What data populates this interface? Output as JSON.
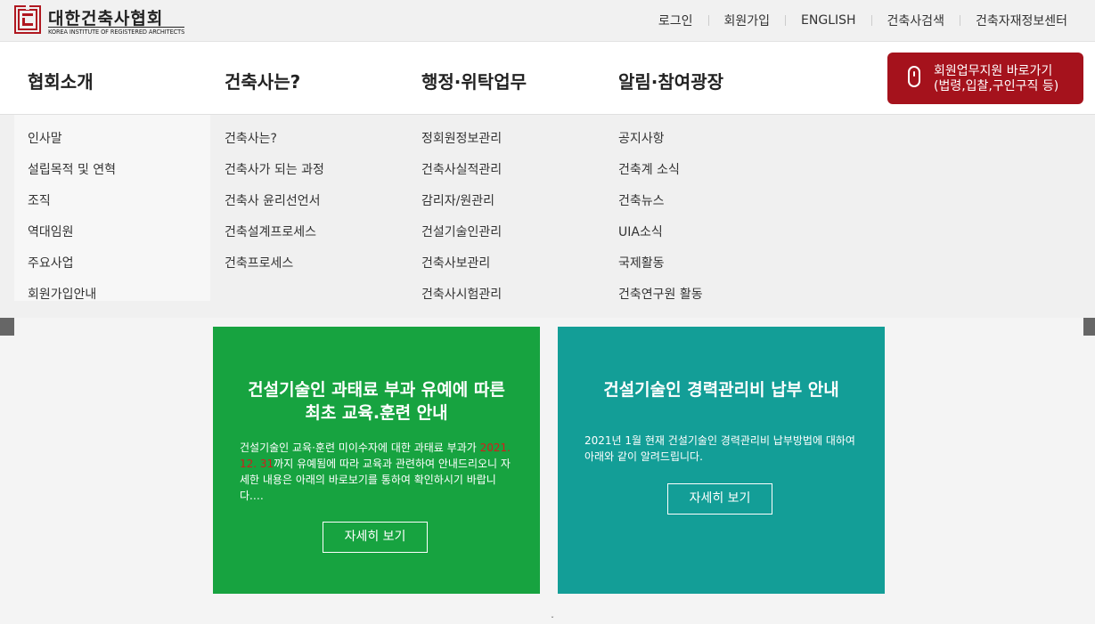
{
  "header": {
    "logo_text": "대한건축사협회",
    "logo_subtitle": "KOREA INSTITUTE OF REGISTERED ARCHITECTS",
    "util_links": [
      "로그인",
      "회원가입",
      "ENGLISH",
      "건축사검색",
      "건축자재정보센터"
    ]
  },
  "gnb": {
    "menus": [
      "협회소개",
      "건축사는?",
      "행정·위탁업무",
      "알림·참여광장"
    ],
    "member_button": {
      "line1": "회원업무지원 바로가기",
      "line2": "(법령,입찰,구인구직 등)"
    }
  },
  "dropdown": {
    "columns": [
      [
        "인사말",
        "설립목적 및 연혁",
        "조직",
        "역대임원",
        "주요사업",
        "회원가입안내"
      ],
      [
        "건축사는?",
        "건축사가 되는 과정",
        "건축사 윤리선언서",
        "건축설계프로세스",
        "건축프로세스"
      ],
      [
        "정회원정보관리",
        "건축사실적관리",
        "감리자/원관리",
        "건설기술인관리",
        "건축사보관리",
        "건축사시험관리"
      ],
      [
        "공지사항",
        "건축계 소식",
        "건축뉴스",
        "UIA소식",
        "국제활동",
        "건축연구원 활동"
      ]
    ]
  },
  "cards": [
    {
      "title_line1": "건설기술인 과태료 부과 유예에 따른",
      "title_line2": "최초 교육.훈련 안내",
      "desc_before": "건설기술인 교육·훈련 미이수자에 대한 과태료 부과가 ",
      "desc_date": "2021. 12. 31",
      "desc_after": "까지 유예됨에 따라 교육과 관련하여 안내드리오니 자세한 내용은 아래의 바로보기를 통하여 확인하시기 바랍니다.…",
      "button": "자세히 보기",
      "color": "#17a340"
    },
    {
      "title_line1": "건설기술인 경력관리비 납부 안내",
      "desc": "2021년 1월 현재 건설기술인 경력관리비 납부방법에 대하여 아래와 같이 알려드립니다.",
      "button": "자세히 보기",
      "color": "#139e97"
    }
  ],
  "colors": {
    "brand_red": "#a5121c",
    "logo_red": "#b01820"
  }
}
